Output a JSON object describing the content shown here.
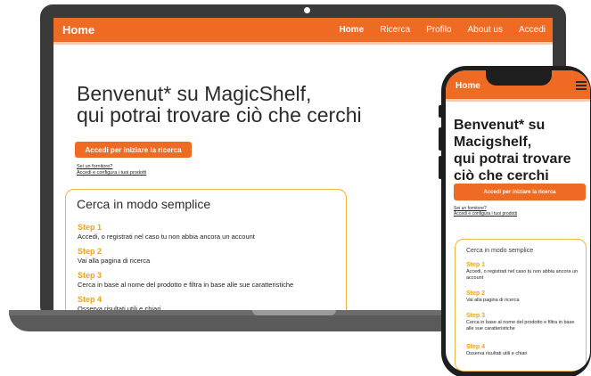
{
  "laptop": {
    "nav": {
      "brand": "Home",
      "links": [
        "Home",
        "Ricerca",
        "Profilo",
        "About us",
        "Accedi"
      ]
    },
    "hero_line1": "Benvenut* su MagicShelf,",
    "hero_line2": "qui potrai trovare ciò che cerchi",
    "cta_label": "Accedi per iniziare la ricerca",
    "supplier_question": "Sei un fornitore?",
    "supplier_link": "Accedi e configura i tuoi prodotti",
    "card": {
      "title": "Cerca in modo semplice",
      "steps": [
        {
          "title": "Step 1",
          "text": "Accedi, o registrati nel caso tu non abbia ancora un account"
        },
        {
          "title": "Step 2",
          "text": "Vai alla pagina di ricerca"
        },
        {
          "title": "Step 3",
          "text": "Cerca in base al nome del prodotto e filtra in base alle sue caratteristiche"
        },
        {
          "title": "Step 4",
          "text": "Osserva risultati utili e chiari"
        }
      ]
    }
  },
  "phone": {
    "nav": {
      "brand": "Home",
      "menu_icon": "hamburger-menu-icon"
    },
    "hero_line1": "Benvenut* su",
    "hero_line2": "Macigshelf,",
    "hero_line3": "qui potrai trovare",
    "hero_line4": "ciò che cerchi",
    "cta_label": "Accedi per iniziare la ricerca",
    "supplier_question": "Sei un fornitore?",
    "supplier_link": "Accedi e configura i tuoi prodotti",
    "card": {
      "title": "Cerca in modo semplice",
      "steps": [
        {
          "title": "Step 1",
          "text": "Accedi, o registrati nel caso tu non abbia ancora un account"
        },
        {
          "title": "Step 2",
          "text": "Vai alla pagina di ricerca"
        },
        {
          "title": "Step 3",
          "text": "Cerca in base al nome del prodotto e filtra in base alle sue caratteristiche"
        },
        {
          "title": "Step 4",
          "text": "Osserva risultati utili e chiari"
        }
      ]
    }
  },
  "colors": {
    "accent": "#ef6a23",
    "step_title": "#f0a21c",
    "card_border": "#f2b43a",
    "device_frame": "#3a3a3a"
  }
}
